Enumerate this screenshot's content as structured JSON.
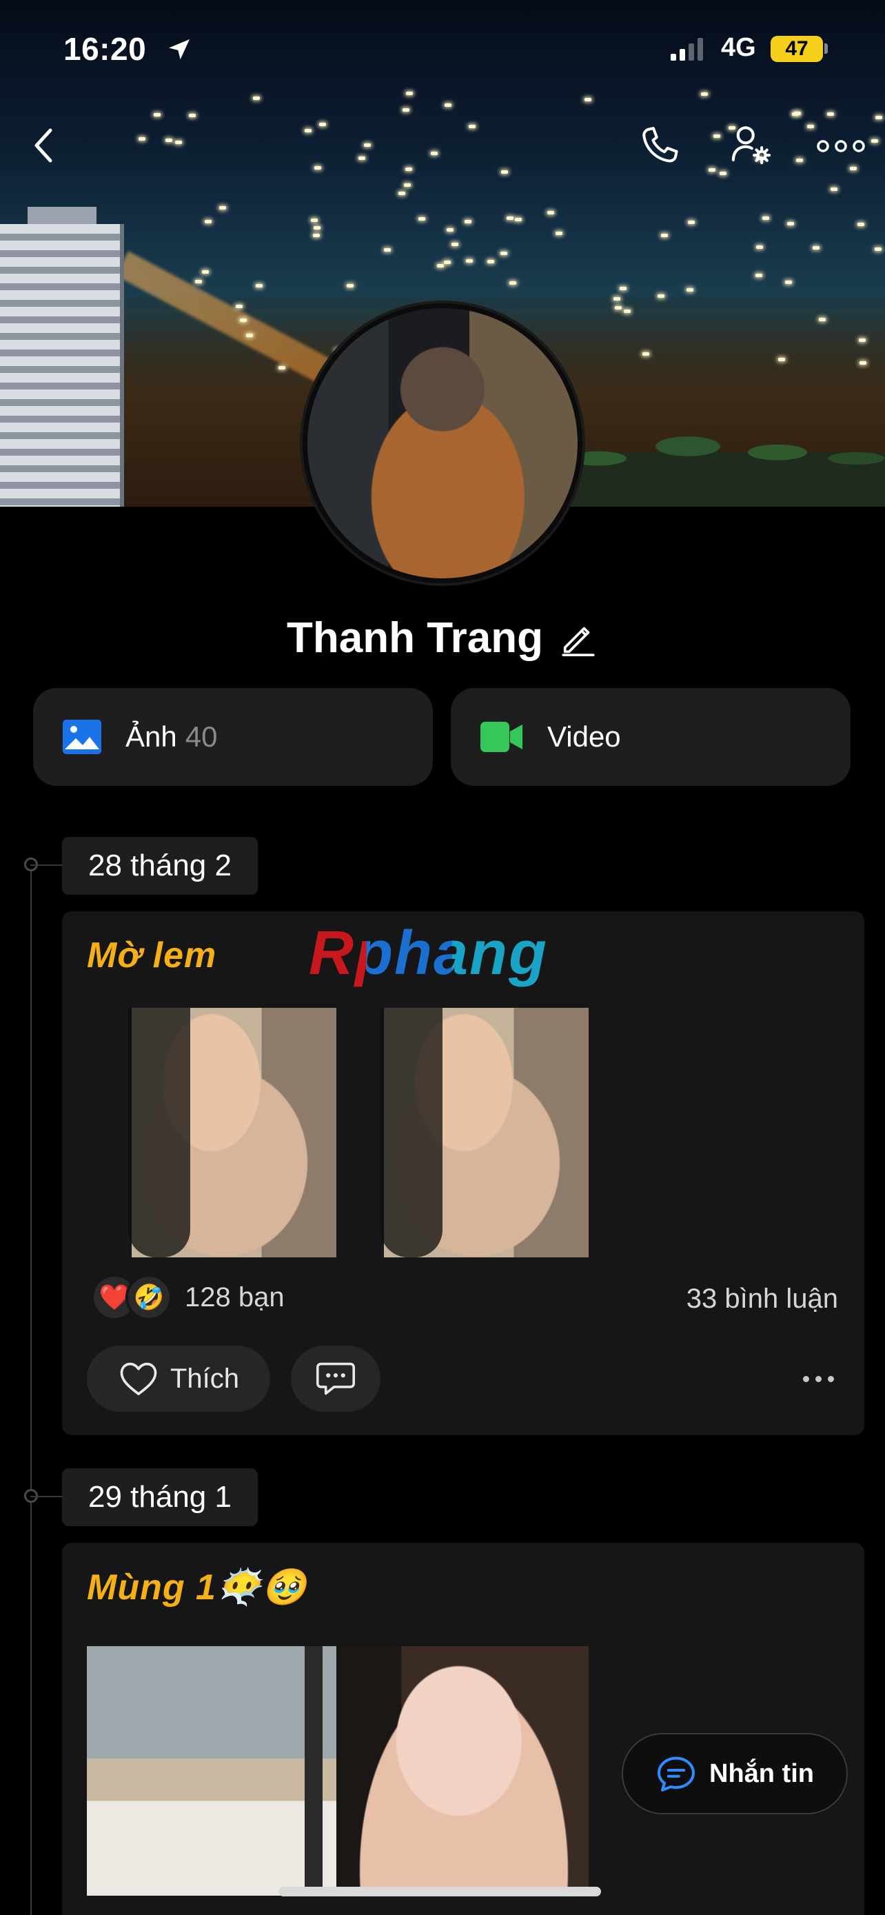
{
  "status_bar": {
    "time": "16:20",
    "network": "4G",
    "battery": "47"
  },
  "profile": {
    "name": "Thanh Trang"
  },
  "media": {
    "photos_label": "Ảnh",
    "photos_count": "40",
    "videos_label": "Video"
  },
  "timeline": [
    {
      "date": "28 tháng 2",
      "title": "Mờ lem",
      "watermark": "Rphang",
      "reactions": [
        "❤️",
        "🤣"
      ],
      "reaction_count": "128 bạn",
      "comment_count": "33 bình luận",
      "like_label": "Thích"
    },
    {
      "date": "29 tháng 1",
      "title": "Mùng 1😶‍🌫️🥹"
    }
  ],
  "message_button": {
    "label": "Nhắn tin"
  },
  "colors": {
    "accent_title": "#f6b015",
    "photo_icon": "#1a73e8",
    "video_icon": "#34c759",
    "message_icon": "#2f8cff"
  },
  "icons": [
    "location-arrow-icon",
    "back-chevron-icon",
    "phone-icon",
    "user-settings-icon",
    "more-horizontal-icon",
    "edit-pencil-icon",
    "image-icon",
    "video-camera-icon",
    "heart-outline-icon",
    "comment-icon",
    "message-bubble-icon"
  ]
}
